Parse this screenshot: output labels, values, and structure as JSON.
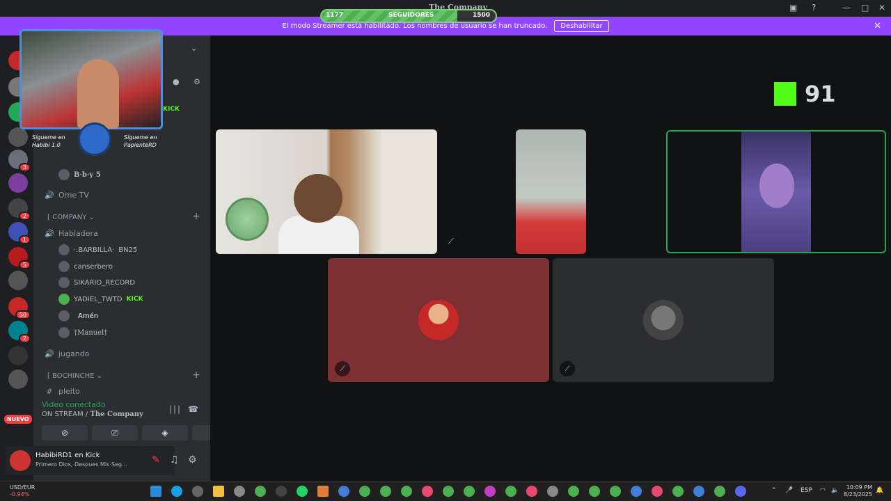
{
  "window": {
    "title": "The Company",
    "follow_progress": {
      "current": "1177",
      "label": "SEGUIDORES",
      "goal": "1500",
      "fraction": 0.78
    }
  },
  "banner": {
    "message": "El modo Streamer está habilitado. Los nombres de usuario se han truncado.",
    "button": "Deshabilitar"
  },
  "server_rail": {
    "badges": [
      "3",
      "2",
      "1",
      "5",
      "50",
      "2"
    ],
    "new_label": "NUEVO"
  },
  "webcam": {
    "left_caption": "Sígueme en",
    "left_handle": "Habibi 1.0",
    "right_caption": "Sígueme en",
    "right_handle": "PapienteRD"
  },
  "sidebar": {
    "top_users": [
      {
        "name": "KICK"
      },
      {
        "name": "B·b·y 5"
      }
    ],
    "channels": [
      {
        "name": "Ome TV",
        "type": "voice"
      }
    ],
    "category_company": "COMPANY",
    "habladera": "Habladera",
    "voice_users": [
      {
        "name": "·.BARBILLA·",
        "extra": "BN25"
      },
      {
        "name": "canserbero",
        "extra": ""
      },
      {
        "name": "SIKARIO_RECORD",
        "extra": ""
      },
      {
        "name": "YADIEL_TWTD",
        "extra": "KICK"
      },
      {
        "name": "",
        "extra": "Amén"
      },
      {
        "name": "†Manuel†",
        "extra": ""
      }
    ],
    "jugando": "jugando",
    "category_bochinche": "BOCHINCHE",
    "pleito": "pleito"
  },
  "voice_panel": {
    "status": "Video conectado",
    "prefix": "ON STREAM /",
    "server": "The Company"
  },
  "user_bar": {
    "name": "HabibiRD1 en Kick",
    "status": "Primero Dios, Despues Mis Seg..."
  },
  "stage": {
    "kick_count": "91"
  },
  "taskbar": {
    "ticker_symbol": "USD/EUR",
    "ticker_change": "-0.94%",
    "language": "ESP",
    "time": "10:09 PM",
    "date": "8/23/2025"
  },
  "colors": {
    "accent_purple": "#9147ff",
    "kick_green": "#53fc18",
    "speaking_green": "#23a55a"
  }
}
